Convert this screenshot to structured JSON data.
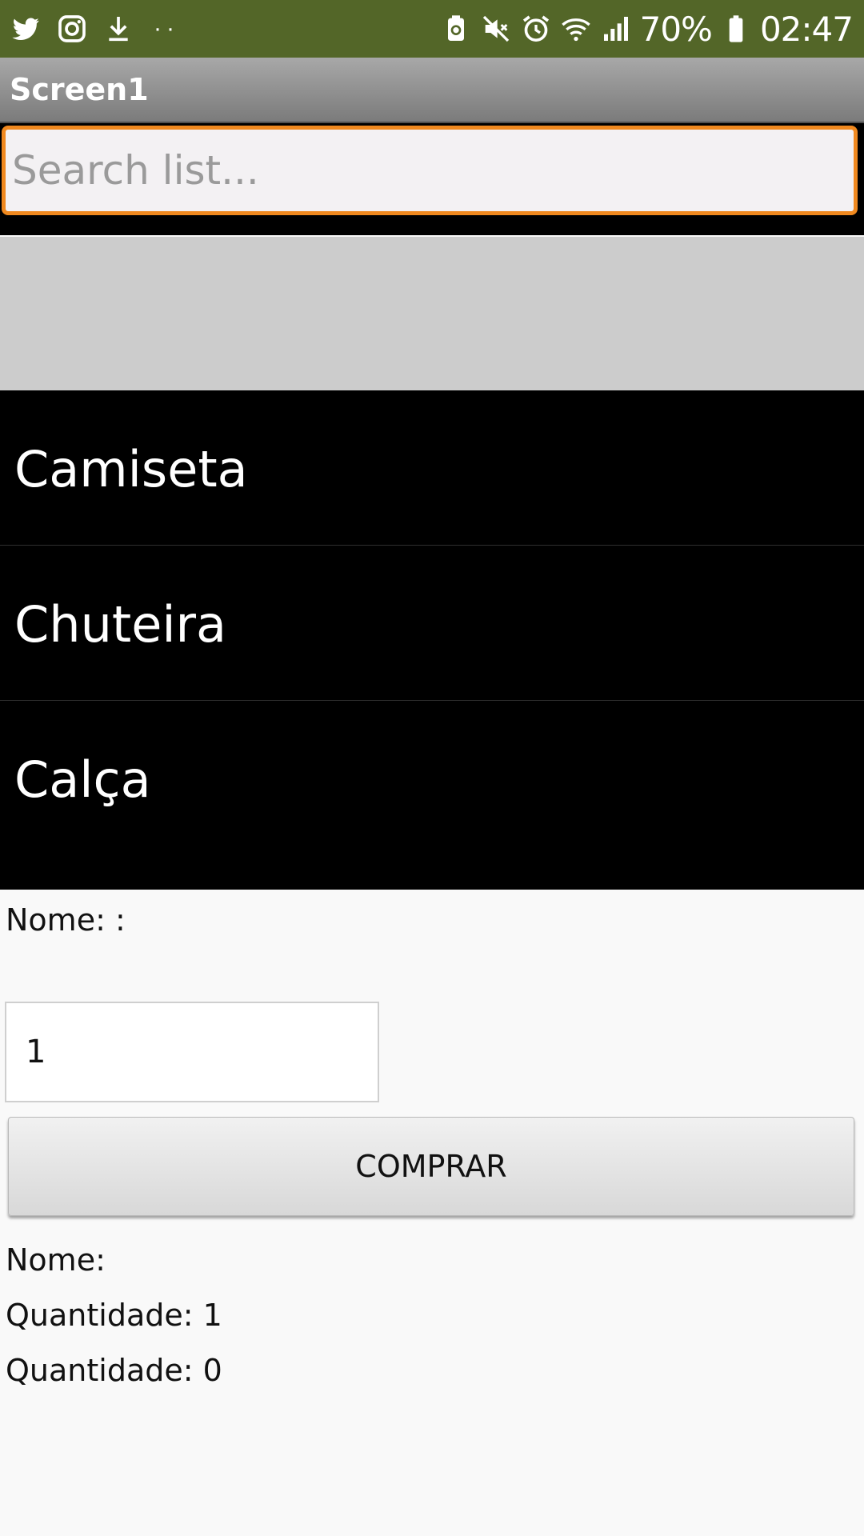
{
  "status_bar": {
    "left_icons": [
      "twitter-icon",
      "instagram-icon",
      "download-icon"
    ],
    "right_icons": [
      "battery-saver-icon",
      "mute-icon",
      "alarm-icon",
      "wifi-icon",
      "signal-icon",
      "battery-icon"
    ],
    "battery_percent": "70%",
    "time": "02:47",
    "background_color": "#536628"
  },
  "title_bar": {
    "title": "Screen1"
  },
  "search": {
    "placeholder": "Search list...",
    "focus_color": "#f0891f"
  },
  "list": {
    "items": [
      "Camiseta",
      "Chuteira",
      "Calça"
    ]
  },
  "details": {
    "name_label": "Nome:  :",
    "quantity_value": "1",
    "buy_button": "COMPRAR",
    "result_name": "Nome:",
    "result_quantity_1": "Quantidade: 1",
    "result_quantity_2": "Quantidade: 0"
  }
}
